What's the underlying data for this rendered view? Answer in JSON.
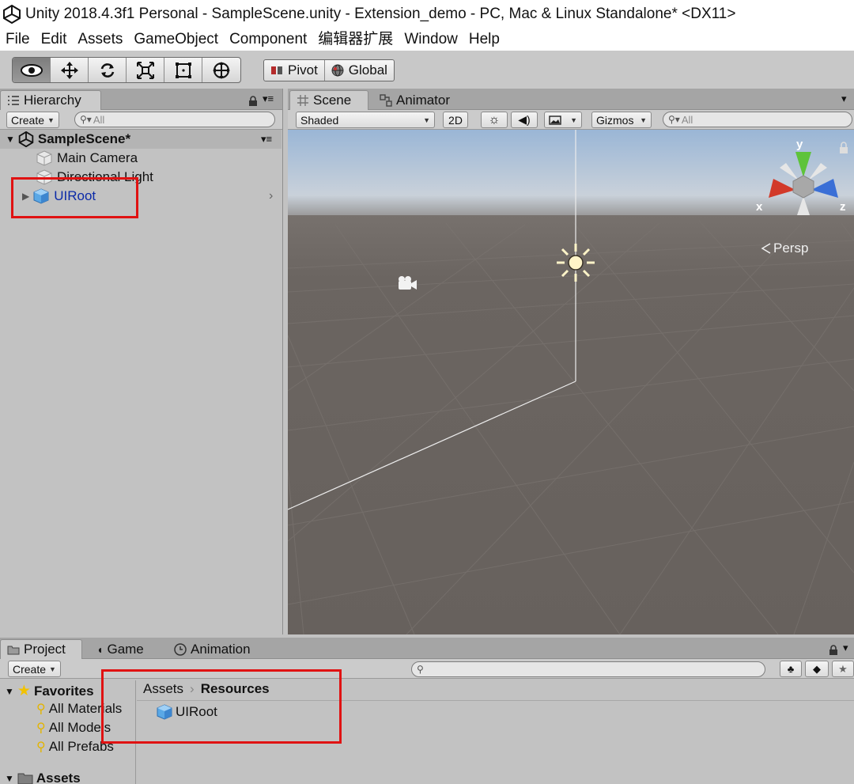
{
  "window": {
    "title": "Unity 2018.4.3f1 Personal - SampleScene.unity - Extension_demo - PC, Mac & Linux Standalone* <DX11>"
  },
  "menu": [
    "File",
    "Edit",
    "Assets",
    "GameObject",
    "Component",
    "编辑器扩展",
    "Window",
    "Help"
  ],
  "toolbar": {
    "pivot_label": "Pivot",
    "global_label": "Global"
  },
  "hierarchy": {
    "tab_label": "Hierarchy",
    "create_label": "Create",
    "search_placeholder": "All",
    "scene_name": "SampleScene*",
    "items": [
      "Main Camera",
      "Directional Light",
      "UIRoot"
    ]
  },
  "scene": {
    "tabs": [
      "Scene",
      "Animator"
    ],
    "shading_mode": "Shaded",
    "mode_2d": "2D",
    "gizmos_label": "Gizmos",
    "search_placeholder": "All",
    "axis_y": "y",
    "axis_x": "x",
    "axis_z": "z",
    "projection": "Persp"
  },
  "project": {
    "tabs": [
      "Project",
      "Game",
      "Animation"
    ],
    "create_label": "Create",
    "favorites_label": "Favorites",
    "favorites": [
      "All Materials",
      "All Models",
      "All Prefabs"
    ],
    "assets_label": "Assets",
    "breadcrumb_root": "Assets",
    "breadcrumb_current": "Resources",
    "files": [
      "UIRoot"
    ]
  },
  "colors": {
    "highlight_box": "#e01212",
    "selected_text": "#0b2aa8",
    "sky_top": "#9ab6d6",
    "ground": "#6b6561"
  }
}
